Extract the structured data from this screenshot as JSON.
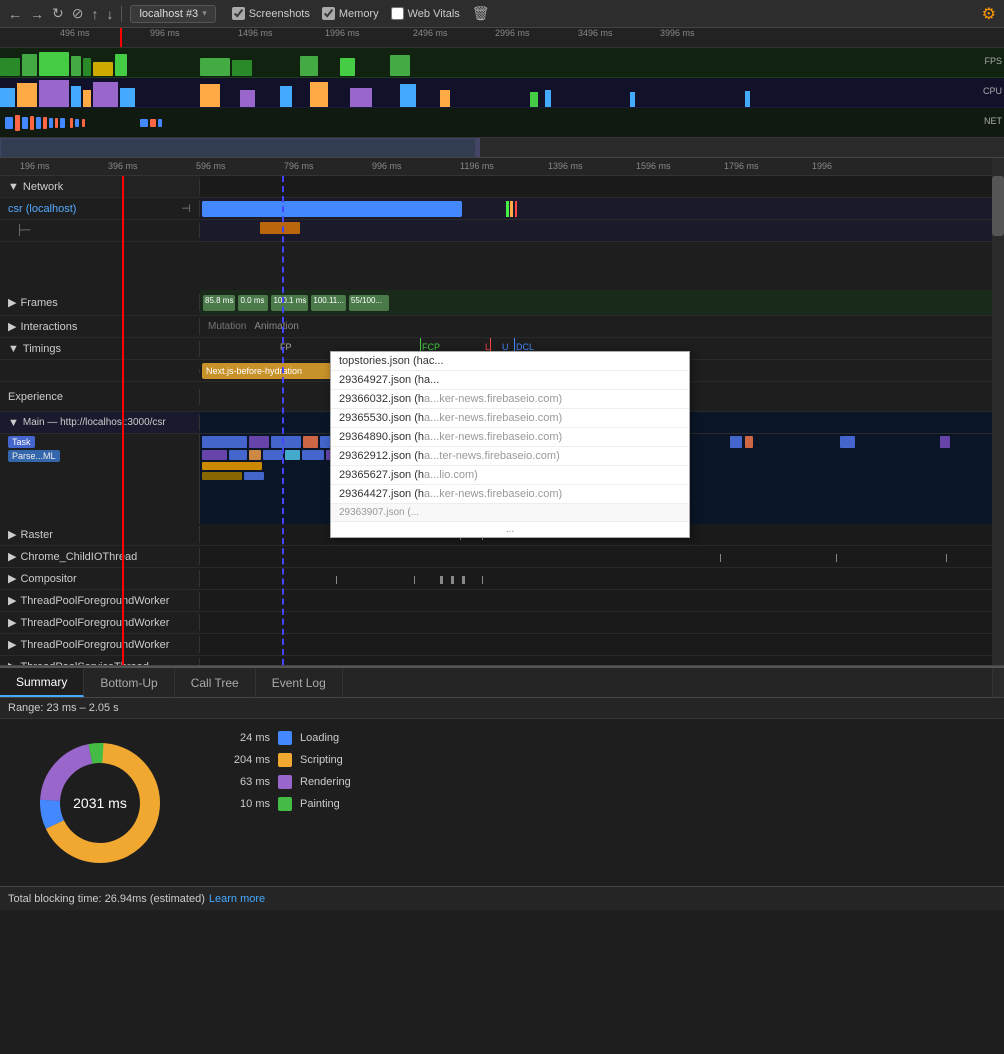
{
  "toolbar": {
    "reload_icon": "↻",
    "stop_icon": "✕",
    "no_stop_icon": "⊘",
    "upload_icon": "↑",
    "download_icon": "↓",
    "url": "localhost #3",
    "dropdown_arrow": "▾",
    "screenshots_label": "Screenshots",
    "memory_label": "Memory",
    "web_vitals_label": "Web Vitals",
    "trash_icon": "🗑",
    "gear_icon": "⚙"
  },
  "overview": {
    "fps_label": "FPS",
    "cpu_label": "CPU",
    "net_label": "NET",
    "ruler_ticks": [
      "496 ms",
      "996 ms",
      "1496 ms",
      "1996 ms",
      "2496 ms",
      "2996 ms",
      "3496 ms",
      "3996 ms"
    ]
  },
  "timeline": {
    "ruler_ticks": [
      "196 ms",
      "396 ms",
      "596 ms",
      "796 ms",
      "996 ms",
      "1196 ms",
      "1396 ms",
      "1596 ms",
      "1796 ms",
      "1996"
    ],
    "network_label": "Network",
    "network_host": "localhost",
    "csr_label": "csr (localhost)",
    "requests": [
      "topstories.json (hac...",
      "29364927.json (ha...",
      "29366032.json (ha...ker-news.firebaseio.com)",
      "29365530.json (ha...ker-news.firebaseio.com)",
      "29364890.json (ha...ker-news.firebaseio.com)",
      "29362912.json (ha...ter-news.firebaseio.com)",
      "29365627.json (ha...lio.com)",
      "29364427.json (ha...ker-news.firebaseio.com)",
      "29363907.json (..."
    ],
    "more_label": "...",
    "frames_label": "Frames",
    "frames_bars": [
      "85.8 ms",
      "0.0 ms",
      "100.1 ms",
      "100.11...",
      "55/100..."
    ],
    "interactions_label": "Interactions",
    "animation_tabs": [
      "Mutation",
      "Animation"
    ],
    "timings_label": "Timings",
    "fp_label": "FP",
    "fcp_label": "FCP",
    "l_label": "L",
    "u_label": "U",
    "dcl_label": "DCL",
    "next_hydration_label": "Next.js-before-hydration",
    "experience_label": "Experience",
    "main_thread_label": "Main — http://localhost:3000/csr",
    "task_label": "Task",
    "parse_label": "Parse...ML",
    "raster_label": "Raster",
    "chrome_io_label": "Chrome_ChildIOThread",
    "compositor_label": "Compositor",
    "thread_pool_workers": [
      "ThreadPoolForegroundWorker",
      "ThreadPoolForegroundWorker",
      "ThreadPoolForegroundWorker",
      "ThreadPoolServiceThread"
    ]
  },
  "bottom_panel": {
    "tabs": [
      "Summary",
      "Bottom-Up",
      "Call Tree",
      "Event Log"
    ],
    "active_tab": "Summary",
    "range_text": "Range: 23 ms – 2.05 s",
    "total_blocking_time": "Total blocking time: 26.94ms (estimated)",
    "learn_more": "Learn more",
    "donut_center_ms": "2031 ms",
    "legend": [
      {
        "ms": "24 ms",
        "color": "#4488ff",
        "label": "Loading"
      },
      {
        "ms": "204 ms",
        "color": "#f0a830",
        "label": "Scripting"
      },
      {
        "ms": "63 ms",
        "color": "#9966cc",
        "label": "Rendering"
      },
      {
        "ms": "10 ms",
        "color": "#44bb44",
        "label": "Painting"
      }
    ]
  }
}
